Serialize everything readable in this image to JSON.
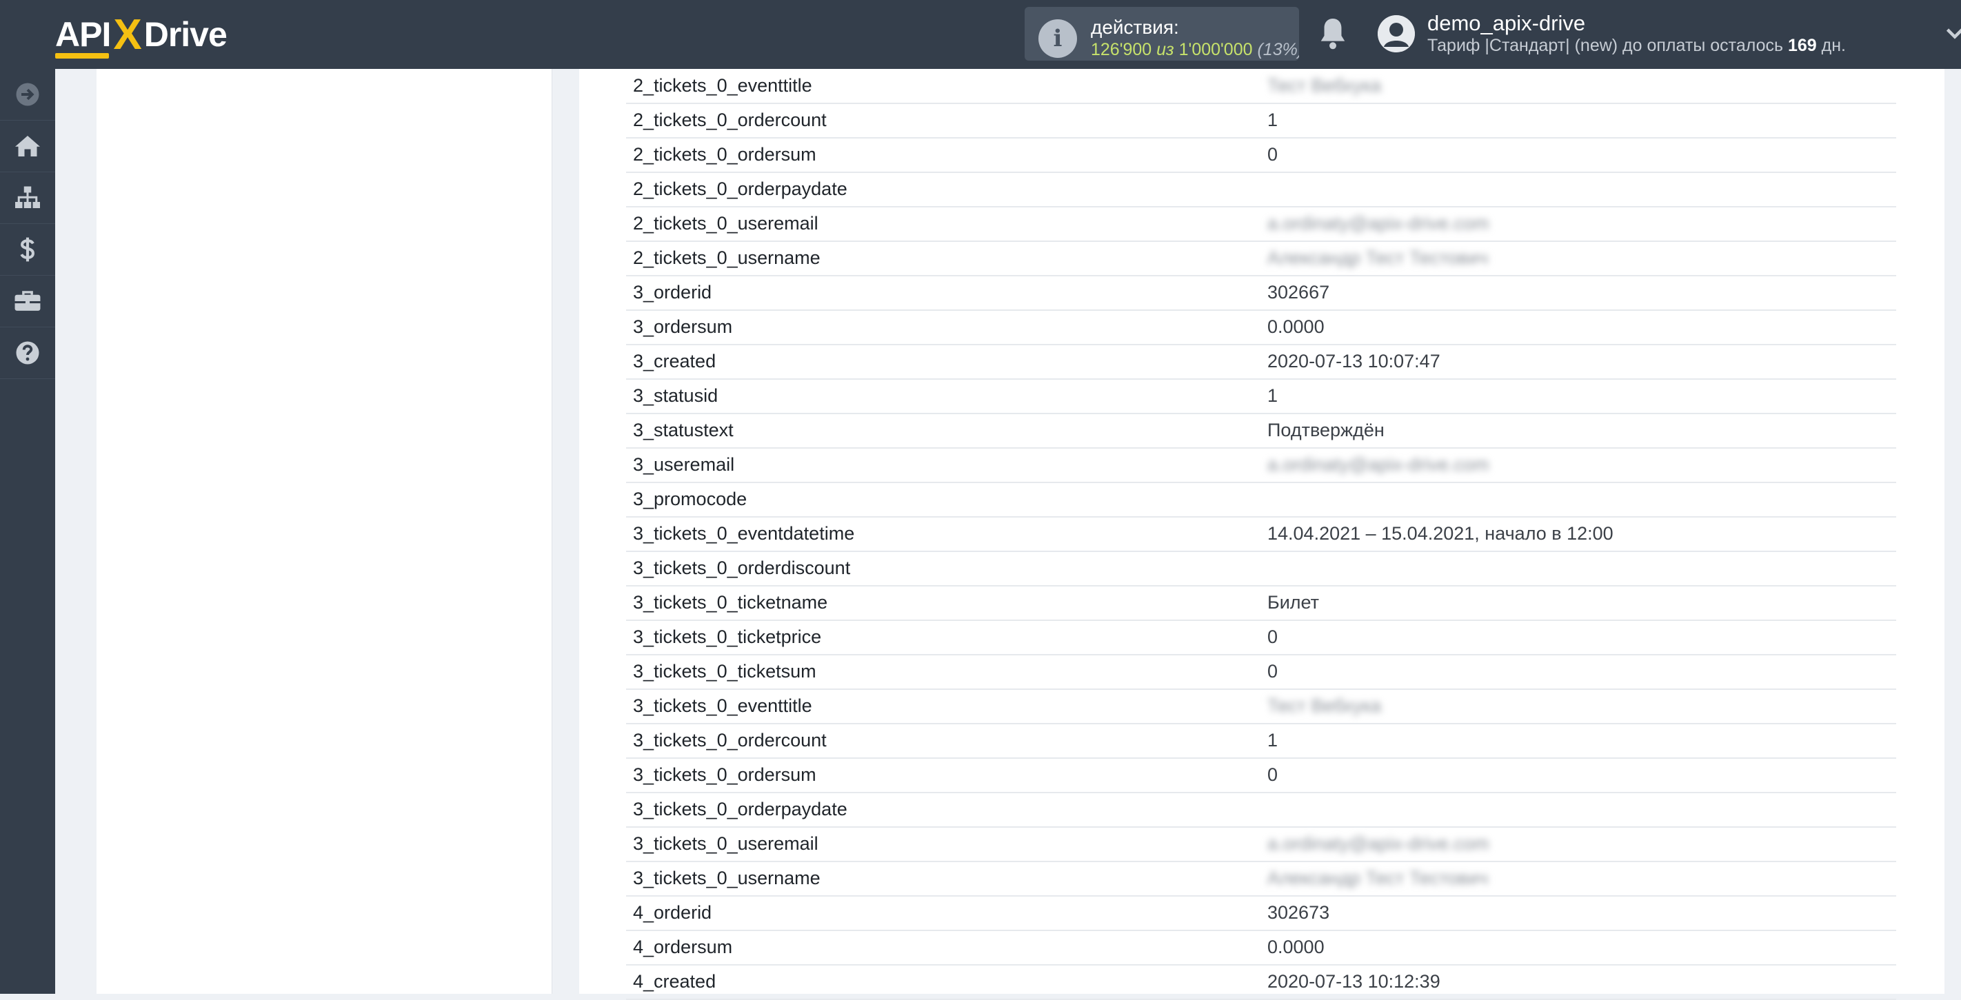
{
  "header": {
    "logo_left": "API",
    "logo_x": "X",
    "logo_right": "Drive",
    "actions_label": "действия:",
    "actions_used": "126'900",
    "actions_of": "из",
    "actions_total": "1'000'000",
    "actions_pct": "(13%)",
    "username": "demo_apix-drive",
    "tariff_prefix": "Тариф |Стандарт| (new) до оплаты осталось",
    "tariff_days": "169",
    "tariff_suffix": "дн."
  },
  "sidebar": {
    "items": [
      "arrow-right-icon",
      "home-icon",
      "sitemap-icon",
      "dollar-icon",
      "briefcase-icon",
      "help-icon"
    ]
  },
  "table": {
    "rows": [
      {
        "key": "2_tickets_0_eventtitle",
        "value": "Тест Вебхука",
        "blurred": true
      },
      {
        "key": "2_tickets_0_ordercount",
        "value": "1",
        "blurred": false
      },
      {
        "key": "2_tickets_0_ordersum",
        "value": "0",
        "blurred": false
      },
      {
        "key": "2_tickets_0_orderpaydate",
        "value": "",
        "blurred": false
      },
      {
        "key": "2_tickets_0_useremail",
        "value": "a.ordinaty@apix-drive.com",
        "blurred": true
      },
      {
        "key": "2_tickets_0_username",
        "value": "Александр Тест Тестович",
        "blurred": true
      },
      {
        "key": "3_orderid",
        "value": "302667",
        "blurred": false
      },
      {
        "key": "3_ordersum",
        "value": "0.0000",
        "blurred": false
      },
      {
        "key": "3_created",
        "value": "2020-07-13 10:07:47",
        "blurred": false
      },
      {
        "key": "3_statusid",
        "value": "1",
        "blurred": false
      },
      {
        "key": "3_statustext",
        "value": "Подтверждён",
        "blurred": false
      },
      {
        "key": "3_useremail",
        "value": "a.ordinaty@apix-drive.com",
        "blurred": true
      },
      {
        "key": "3_promocode",
        "value": "",
        "blurred": false
      },
      {
        "key": "3_tickets_0_eventdatetime",
        "value": "14.04.2021 – 15.04.2021, начало в 12:00",
        "blurred": false
      },
      {
        "key": "3_tickets_0_orderdiscount",
        "value": "",
        "blurred": false
      },
      {
        "key": "3_tickets_0_ticketname",
        "value": "Билет",
        "blurred": false
      },
      {
        "key": "3_tickets_0_ticketprice",
        "value": "0",
        "blurred": false
      },
      {
        "key": "3_tickets_0_ticketsum",
        "value": "0",
        "blurred": false
      },
      {
        "key": "3_tickets_0_eventtitle",
        "value": "Тест Вебхука",
        "blurred": true
      },
      {
        "key": "3_tickets_0_ordercount",
        "value": "1",
        "blurred": false
      },
      {
        "key": "3_tickets_0_ordersum",
        "value": "0",
        "blurred": false
      },
      {
        "key": "3_tickets_0_orderpaydate",
        "value": "",
        "blurred": false
      },
      {
        "key": "3_tickets_0_useremail",
        "value": "a.ordinaty@apix-drive.com",
        "blurred": true
      },
      {
        "key": "3_tickets_0_username",
        "value": "Александр Тест Тестович",
        "blurred": true
      },
      {
        "key": "4_orderid",
        "value": "302673",
        "blurred": false
      },
      {
        "key": "4_ordersum",
        "value": "0.0000",
        "blurred": false
      },
      {
        "key": "4_created",
        "value": "2020-07-13 10:12:39",
        "blurred": false
      }
    ]
  }
}
